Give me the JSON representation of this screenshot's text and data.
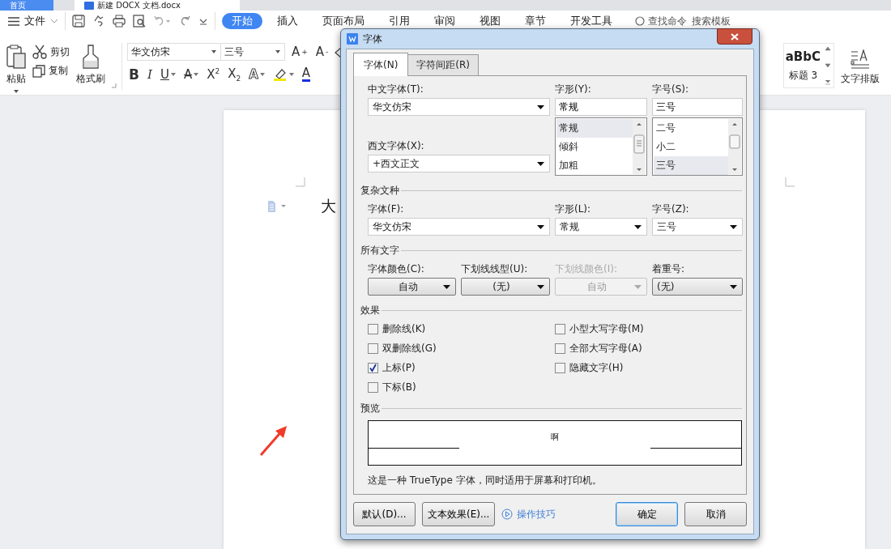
{
  "app_tabs": [
    {
      "label": "首页",
      "selected": false
    },
    {
      "label": "新建 DOCX 文档.docx",
      "selected": true
    }
  ],
  "menu": {
    "file": "文件",
    "tabs": [
      {
        "label": "开始",
        "selected": true
      },
      {
        "label": "插入",
        "selected": false
      },
      {
        "label": "页面布局",
        "selected": false
      },
      {
        "label": "引用",
        "selected": false
      },
      {
        "label": "审阅",
        "selected": false
      },
      {
        "label": "视图",
        "selected": false
      },
      {
        "label": "章节",
        "selected": false
      },
      {
        "label": "开发工具",
        "selected": false
      }
    ],
    "search": "查找命令",
    "template": "搜索模板"
  },
  "ribbon": {
    "paste": "粘贴",
    "cut": "剪切",
    "copy": "复制",
    "format_painter": "格式刷",
    "font": "华文仿宋",
    "size": "三号",
    "size_buttons": [
      {
        "label": "A$^{+}$"
      },
      {
        "label": "A$^{-}$"
      }
    ],
    "format_buttons": [
      {
        "kind": "bold",
        "label": "B"
      },
      {
        "kind": "italic",
        "label": "I"
      },
      {
        "kind": "underline",
        "label": "U"
      },
      {
        "kind": "strike",
        "label": "A"
      },
      {
        "kind": "script",
        "label": "X$^{2}$"
      },
      {
        "kind": "script",
        "label": "X$_{2}$"
      },
      {
        "kind": "outline",
        "label": "A"
      },
      {
        "kind": "highlight"
      },
      {
        "kind": "color",
        "label": "A"
      }
    ],
    "style_sample": "aBbC",
    "style_name": "标题 3",
    "text_layout": "文字排版"
  },
  "document": {
    "text": "大"
  },
  "dialog": {
    "title": "字体",
    "tabs": [
      {
        "label": "字体(N)",
        "selected": true
      },
      {
        "label": "字符间距(R)",
        "selected": false
      }
    ],
    "chinese_font": {
      "label": "中文字体(T):",
      "value": "华文仿宋"
    },
    "western_font": {
      "label": "西文字体(X):",
      "value": "+西文正文"
    },
    "font_style": {
      "label": "字形(Y):",
      "value": "常规",
      "options": [
        {
          "label": "常规",
          "selected": true
        },
        {
          "label": "倾斜",
          "selected": false
        },
        {
          "label": "加粗",
          "selected": false
        }
      ]
    },
    "font_size": {
      "label": "字号(S):",
      "value": "三号",
      "options": [
        {
          "label": "二号",
          "selected": false
        },
        {
          "label": "小二",
          "selected": false
        },
        {
          "label": "三号",
          "selected": true
        }
      ]
    },
    "complex_title": "复杂文种",
    "complex": [
      {
        "label": "字体(F):",
        "value": "华文仿宋"
      },
      {
        "label": "字形(L):",
        "value": "常规"
      },
      {
        "label": "字号(Z):",
        "value": "三号"
      }
    ],
    "all_text_title": "所有文字",
    "all_text": [
      {
        "label": "字体颜色(C):",
        "value": "自动",
        "disabled": false
      },
      {
        "label": "下划线线型(U):",
        "value": "(无)",
        "disabled": false
      },
      {
        "label": "下划线颜色(I):",
        "value": "自动",
        "disabled": true
      },
      {
        "label": "着重号:",
        "value": "(无)",
        "disabled": false
      }
    ],
    "effects_title": "效果",
    "effects": {
      "left": [
        {
          "label": "删除线(K)",
          "checked": false
        },
        {
          "label": "双删除线(G)",
          "checked": false
        },
        {
          "label": "上标(P)",
          "checked": true
        },
        {
          "label": "下标(B)",
          "checked": false
        }
      ],
      "right": [
        {
          "label": "小型大写字母(M)",
          "checked": false
        },
        {
          "label": "全部大写字母(A)",
          "checked": false
        },
        {
          "label": "隐藏文字(H)",
          "checked": false
        }
      ]
    },
    "preview_title": "预览",
    "preview_sample": "啊",
    "description": "这是一种 TrueType 字体，同时适用于屏幕和打印机。",
    "buttons": [
      {
        "label": "默认(D)...",
        "kind": "plain"
      },
      {
        "label": "文本效果(E)...",
        "kind": "plain"
      },
      {
        "label": "操作技巧",
        "kind": "link"
      },
      {
        "label": "确定",
        "kind": "default"
      },
      {
        "label": "取消",
        "kind": "plain"
      }
    ]
  }
}
